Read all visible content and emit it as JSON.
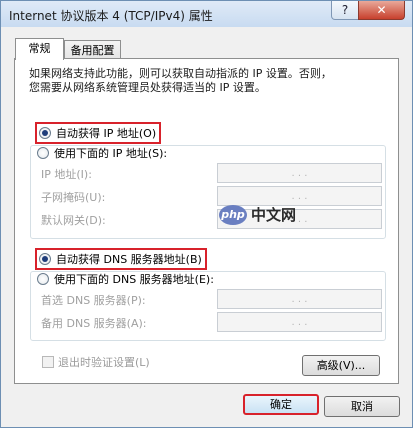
{
  "window": {
    "title": "Internet 协议版本 4 (TCP/IPv4) 属性",
    "help_label": "?",
    "close_label": "✕"
  },
  "tabs": [
    {
      "label": "常规",
      "active": true
    },
    {
      "label": "备用配置",
      "active": false
    }
  ],
  "intro": {
    "line1": "如果网络支持此功能，则可以获取自动指派的 IP 设置。否则，",
    "line2": "您需要从网络系统管理员处获得适当的 IP 设置。"
  },
  "ip_section": {
    "auto_label": "自动获得 IP 地址(O)",
    "auto_selected": true,
    "manual_label": "使用下面的 IP 地址(S):",
    "fields": [
      {
        "label": "IP 地址(I):",
        "value": ". . ."
      },
      {
        "label": "子网掩码(U):",
        "value": ". . ."
      },
      {
        "label": "默认网关(D):",
        "value": ". . ."
      }
    ]
  },
  "dns_section": {
    "auto_label": "自动获得 DNS 服务器地址(B)",
    "auto_selected": true,
    "manual_label": "使用下面的 DNS 服务器地址(E):",
    "fields": [
      {
        "label": "首选 DNS 服务器(P):",
        "value": ". . ."
      },
      {
        "label": "备用 DNS 服务器(A):",
        "value": ". . ."
      }
    ]
  },
  "validate_checkbox": {
    "label": "退出时验证设置(L)",
    "checked": false
  },
  "buttons": {
    "advanced": "高级(V)...",
    "ok": "确定",
    "cancel": "取消"
  },
  "watermark": {
    "logo_text": "php",
    "text": "中文网"
  },
  "colors": {
    "highlight": "#d8222b",
    "titlebar": "#c8dbf1",
    "close_button": "#c7402d"
  }
}
